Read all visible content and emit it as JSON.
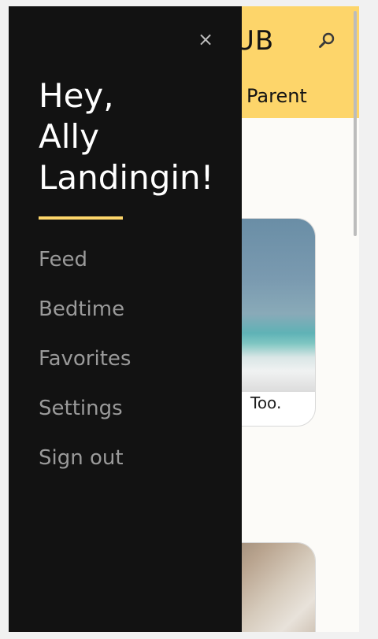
{
  "app": {
    "logo_text": "UB",
    "tab_label": "Parent",
    "brand_color": "#fdd56a"
  },
  "cards": [
    {
      "caption": "Too."
    },
    {
      "caption": ""
    }
  ],
  "drawer": {
    "greeting_line_1": "Hey,",
    "greeting_line_2": "Ally",
    "greeting_line_3": "Landingin!",
    "close_glyph": "×",
    "menu": [
      {
        "label": "Feed"
      },
      {
        "label": "Bedtime"
      },
      {
        "label": "Favorites"
      },
      {
        "label": "Settings"
      },
      {
        "label": "Sign out"
      }
    ]
  },
  "icons": {
    "search": "search-icon",
    "close": "close-icon"
  }
}
